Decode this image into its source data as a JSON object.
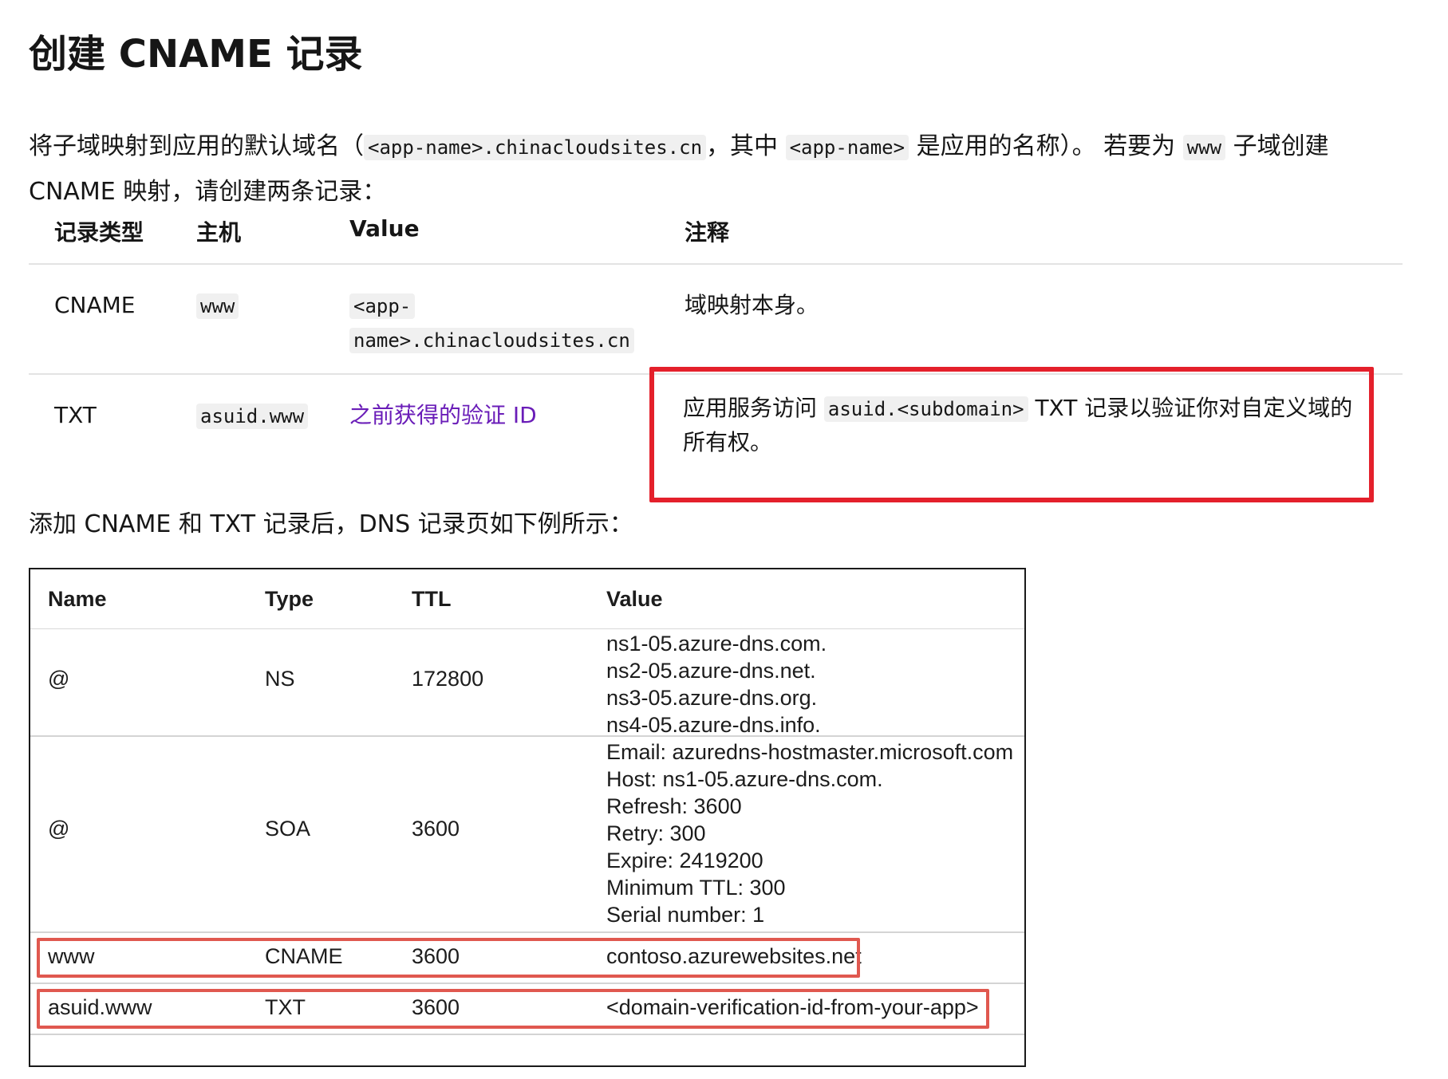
{
  "heading": "创建 CNAME 记录",
  "intro": {
    "part1": "将子域映射到应用的默认域名（",
    "code1": "<app-name>.chinacloudsites.cn",
    "part2": "，其中 ",
    "code2": "<app-name>",
    "part3": " 是应用的名称）。 若要为 ",
    "code3": "www",
    "part4": " 子域创建 CNAME 映射，请创建两条记录："
  },
  "records_table": {
    "headers": {
      "type": "记录类型",
      "host": "主机",
      "value": "Value",
      "note": "注释"
    },
    "row1": {
      "type": "CNAME",
      "host": "www",
      "value_line1": "<app-",
      "value_line2": "name>.chinacloudsites.cn",
      "note": "域映射本身。"
    },
    "row2": {
      "type": "TXT",
      "host": "asuid.www",
      "value_link": "之前获得的验证 ID",
      "note_part1": "应用服务访问 ",
      "note_code": "asuid.<subdomain>",
      "note_part2": " TXT 记录以验证你对自定义域的所有权。"
    }
  },
  "after_text": "添加 CNAME 和 TXT 记录后，DNS 记录页如下例所示：",
  "dns_table": {
    "headers": {
      "name": "Name",
      "type": "Type",
      "ttl": "TTL",
      "value": "Value"
    },
    "ns": {
      "name": "@",
      "type": "NS",
      "ttl": "172800",
      "v1": "ns1-05.azure-dns.com.",
      "v2": "ns2-05.azure-dns.net.",
      "v3": "ns3-05.azure-dns.org.",
      "v4": "ns4-05.azure-dns.info."
    },
    "soa": {
      "name": "@",
      "type": "SOA",
      "ttl": "3600",
      "v1": "Email: azuredns-hostmaster.microsoft.com",
      "v2": "Host: ns1-05.azure-dns.com.",
      "v3": "Refresh: 3600",
      "v4": "Retry: 300",
      "v5": "Expire: 2419200",
      "v6": "Minimum TTL: 300",
      "v7": "Serial number: 1"
    },
    "www": {
      "name": "www",
      "type": "CNAME",
      "ttl": "3600",
      "value": "contoso.azurewebsites.net"
    },
    "txt": {
      "name": "asuid.www",
      "type": "TXT",
      "ttl": "3600",
      "value": "<domain-verification-id-from-your-app>"
    }
  },
  "colors": {
    "highlight_red": "#e4202b",
    "outline_red": "#e0584f",
    "link_purple": "#6a1db8"
  }
}
